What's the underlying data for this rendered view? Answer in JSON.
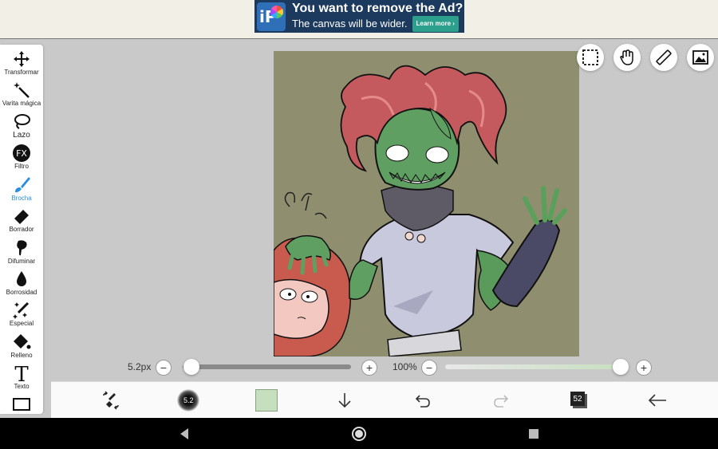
{
  "ad": {
    "title": "You want to remove the Ad?",
    "subtitle": "The canvas will be wider.",
    "button": "Learn more ›",
    "logo_text": "iP"
  },
  "tools": [
    {
      "label": "Transformar",
      "icon": "move-icon"
    },
    {
      "label": "Varita mágica",
      "icon": "magic-wand-icon"
    },
    {
      "label": "Lazo",
      "icon": "lasso-icon"
    },
    {
      "label": "Filtro",
      "icon": "fx-icon",
      "glyph": "FX"
    },
    {
      "label": "Brocha",
      "icon": "brush-icon",
      "active": true
    },
    {
      "label": "Borrador",
      "icon": "eraser-icon"
    },
    {
      "label": "Difuminar",
      "icon": "smudge-icon"
    },
    {
      "label": "Borrosidad",
      "icon": "blur-drop-icon"
    },
    {
      "label": "Especial",
      "icon": "sparkle-pen-icon"
    },
    {
      "label": "Relleno",
      "icon": "fill-icon"
    },
    {
      "label": "Texto",
      "icon": "text-icon",
      "glyph": "T"
    }
  ],
  "brush_size": {
    "label": "5.2px",
    "minus": "−",
    "plus": "+",
    "level": 0.02
  },
  "opacity": {
    "label": "100%",
    "minus": "−",
    "plus": "+",
    "level": 1.0
  },
  "bottom": {
    "brush_size_badge": "5.2",
    "current_color": "#c6dfbe",
    "layers_count": "52"
  },
  "colors": {
    "accent": "#2a8fe0",
    "canvas_bg": "#8f8f70"
  }
}
